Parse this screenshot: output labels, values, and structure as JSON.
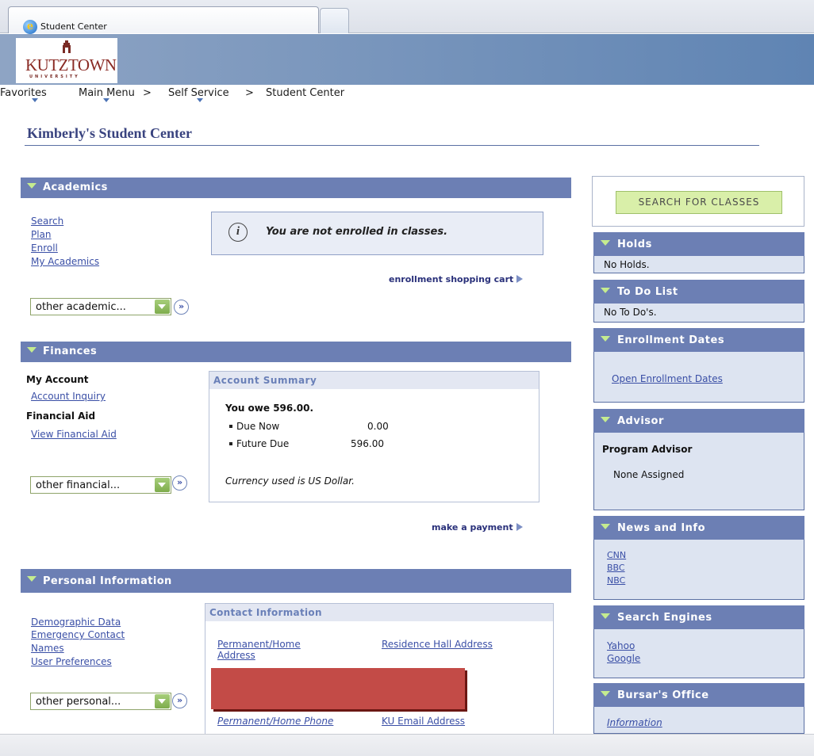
{
  "browser": {
    "tab_title": "Student Center",
    "tab_icon": "ie-icon"
  },
  "logo": {
    "name": "KUTZTOWN",
    "sub": "UNIVERSITY"
  },
  "nav": {
    "favorites": "Favorites",
    "main_menu": "Main Menu",
    "sep1": ">",
    "self_service": "Self Service",
    "sep2": ">",
    "student_center": "Student Center"
  },
  "page_title": "Kimberly's Student Center",
  "academics": {
    "header": "Academics",
    "links": [
      "Search",
      "Plan",
      "Enroll",
      "My Academics"
    ],
    "notice": "You are not enrolled in classes.",
    "cart_link": "enrollment shopping cart",
    "dropdown": "other academic..."
  },
  "finances": {
    "header": "Finances",
    "my_account_label": "My Account",
    "account_inquiry": "Account Inquiry",
    "financial_aid_label": "Financial Aid",
    "view_financial_aid": "View Financial Aid",
    "dropdown": "other financial...",
    "summary": {
      "title": "Account Summary",
      "you_owe": "You owe 596.00.",
      "due_now_label": "Due Now",
      "due_now_value": "0.00",
      "future_due_label": "Future Due",
      "future_due_value": "596.00",
      "currency_note": "Currency used is US Dollar."
    },
    "payment_link": "make a payment"
  },
  "personal": {
    "header": "Personal Information",
    "links": [
      "Demographic Data",
      "Emergency Contact",
      "Names",
      "User Preferences"
    ],
    "dropdown": "other personal...",
    "contact": {
      "title": "Contact Information",
      "home_address": "Permanent/Home Address",
      "residence_address": "Residence Hall Address",
      "home_phone": "Permanent/Home Phone",
      "ku_email": "KU Email Address"
    }
  },
  "right": {
    "search_button": "Search For Classes",
    "holds": {
      "header": "Holds",
      "text": "No Holds."
    },
    "todo": {
      "header": "To Do List",
      "text": "No To Do's."
    },
    "enrollment_dates": {
      "header": "Enrollment Dates",
      "link": "Open Enrollment Dates"
    },
    "advisor": {
      "header": "Advisor",
      "label": "Program Advisor",
      "value": "None Assigned"
    },
    "news": {
      "header": "News and Info",
      "links": [
        "CNN",
        "BBC",
        "NBC"
      ]
    },
    "search_engines": {
      "header": "Search Engines",
      "links": [
        "Yahoo",
        "Google"
      ]
    },
    "bursar": {
      "header": "Bursar's Office",
      "link": "Information"
    }
  },
  "colors": {
    "section_header": "#6c7fb4",
    "link": "#3a4fa6",
    "title": "#39437f",
    "redaction": "#c34b47"
  }
}
